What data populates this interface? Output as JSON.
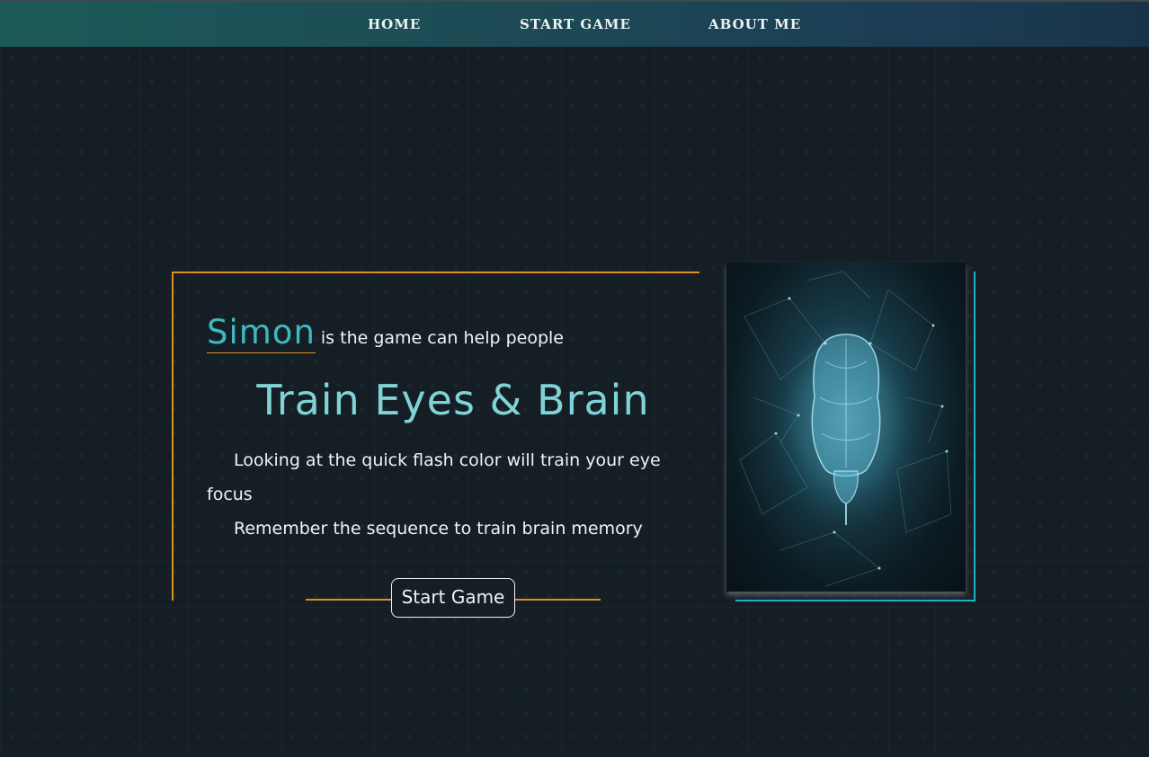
{
  "nav": {
    "home": "HOME",
    "start_game": "START GAME",
    "about_me": "ABOUT ME"
  },
  "hero": {
    "simon": "Simon",
    "intro": "is the game can help people",
    "headline": "Train Eyes & Brain",
    "description_1": "Looking at the quick flash color will train your eye focus",
    "description_2": "Remember the sequence to train brain memory",
    "button": "Start Game"
  },
  "colors": {
    "accent_orange": "#d9921f",
    "accent_teal": "#3fb8c0",
    "headline": "#7fd3d6",
    "frame_teal": "#1fb3c4",
    "background": "#151e25"
  },
  "images": {
    "brain": "brain-hologram-icon"
  }
}
